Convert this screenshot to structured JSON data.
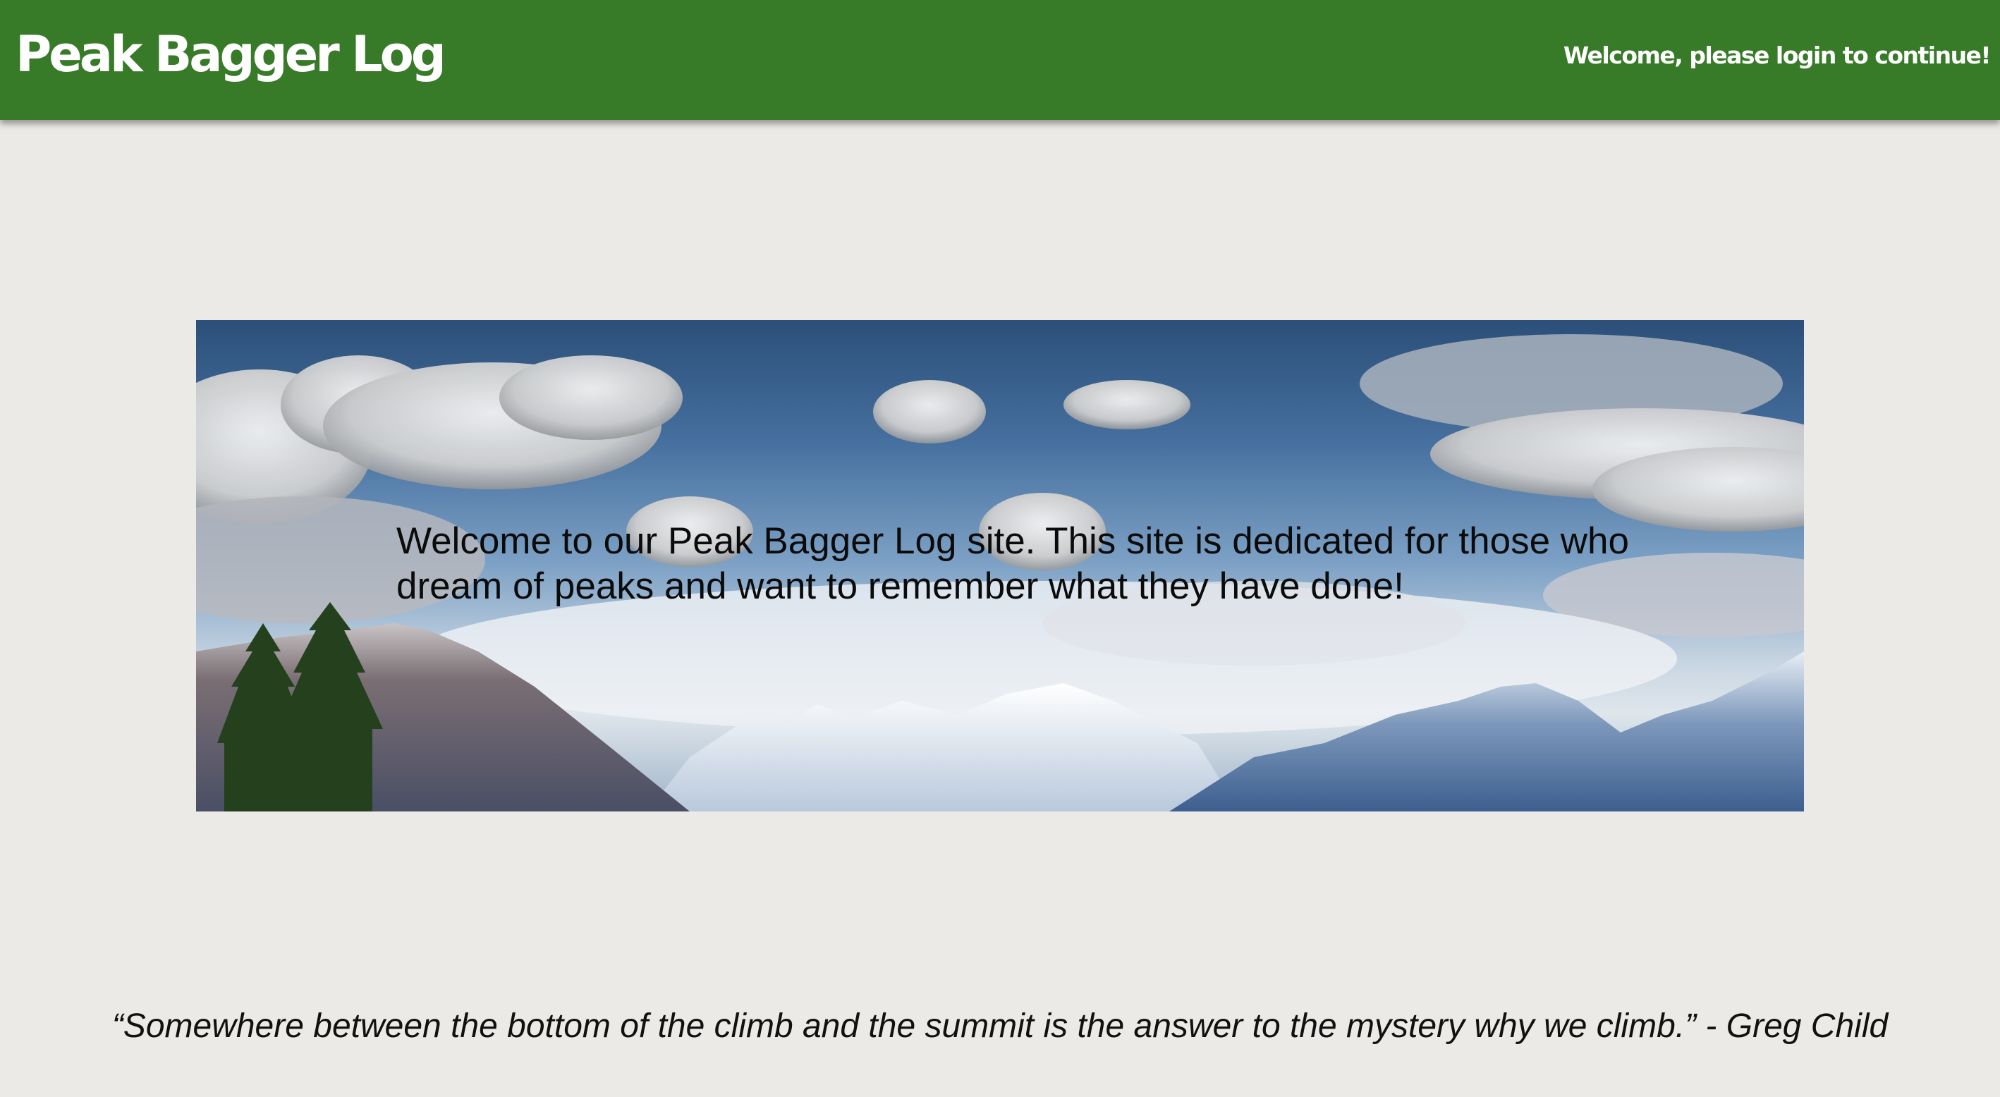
{
  "header": {
    "title": "Peak Bagger Log",
    "login_message": "Welcome, please login to continue!",
    "background_color": "#377a27"
  },
  "hero": {
    "text": "Welcome to our Peak Bagger Log site. This site is dedicated for those who dream of peaks and want to remember what they have done!",
    "image_description_icon": "mountain-landscape-image"
  },
  "quote": {
    "text": "“Somewhere between the bottom of the climb and the summit is the answer to the mystery why we climb.” - Greg Child"
  },
  "colors": {
    "page_background": "#ebeae6",
    "text": "#111111"
  }
}
